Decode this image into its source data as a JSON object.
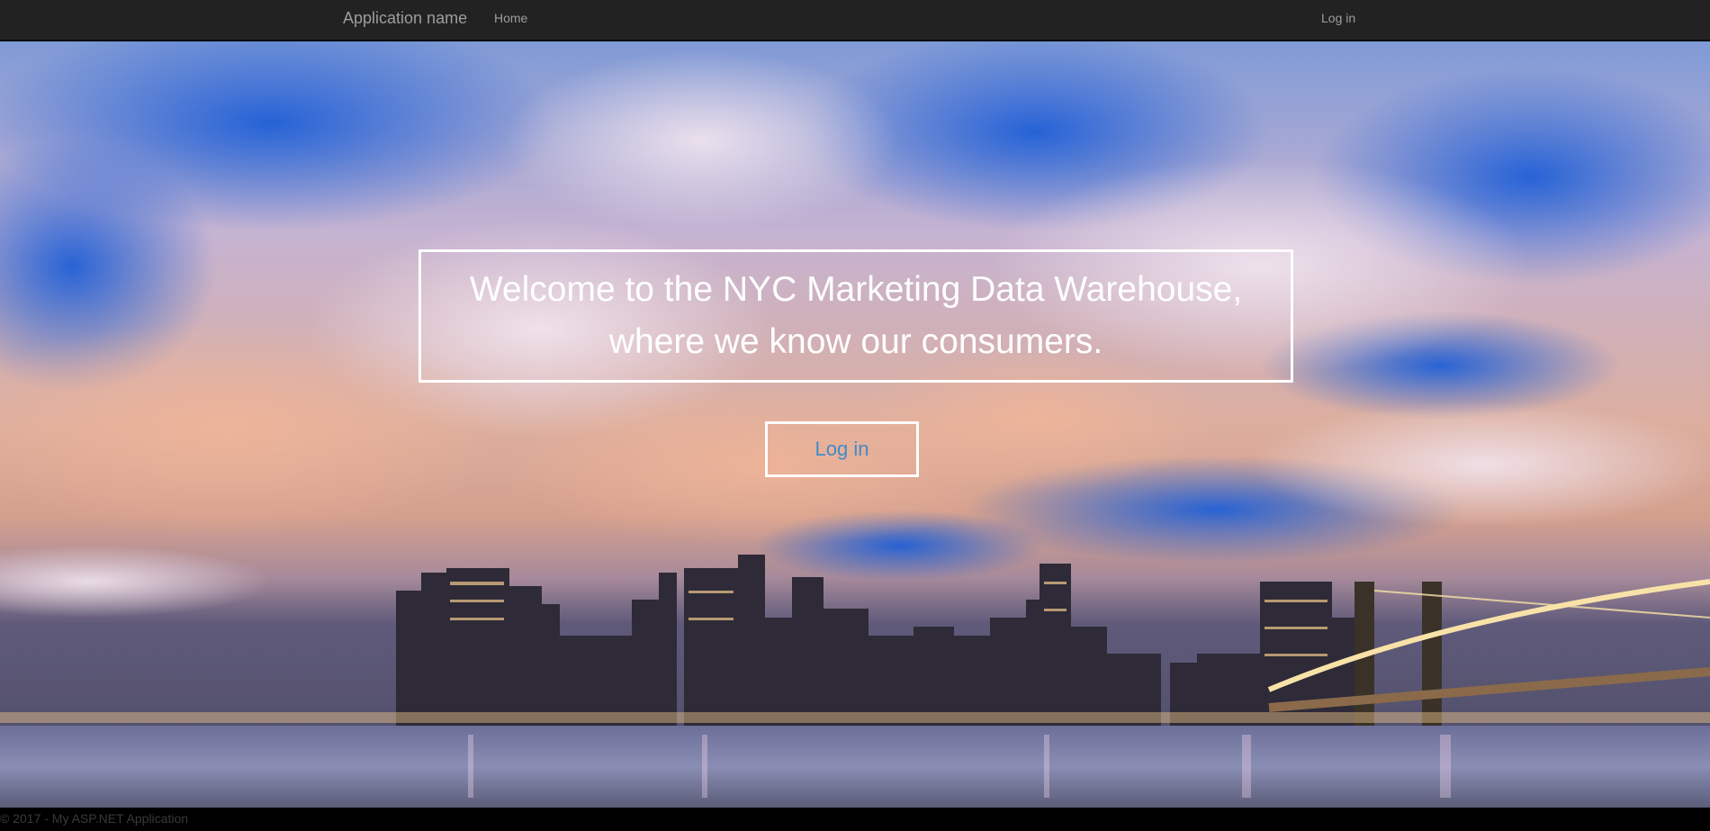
{
  "navbar": {
    "brand": "Application name",
    "links": [
      {
        "label": "Home"
      }
    ],
    "right_links": [
      {
        "label": "Log in"
      }
    ]
  },
  "hero": {
    "welcome_line1": "Welcome to the NYC Marketing Data Warehouse,",
    "welcome_line2": "where we know our consumers.",
    "login_button": "Log in",
    "background": "nyc-skyline-photo"
  },
  "footer": {
    "text": "© 2017 - My ASP.NET Application"
  },
  "colors": {
    "navbar_bg": "#222222",
    "nav_text": "#9d9d9d",
    "button_text": "#428bca",
    "footer_bg": "#000000"
  }
}
